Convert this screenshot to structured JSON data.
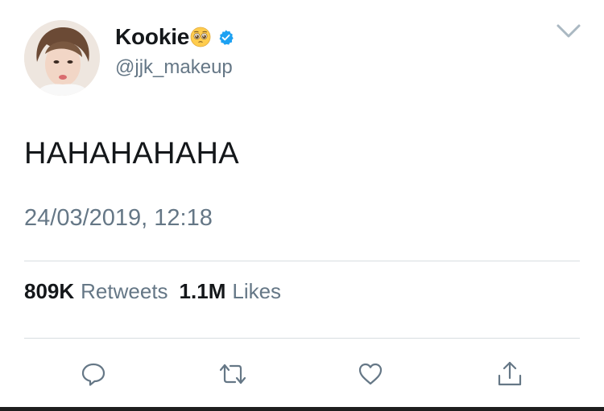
{
  "tweet": {
    "display_name": "Kookie",
    "name_emoji": "pleading-face-emoji",
    "verified_icon": "verified-badge-icon",
    "handle": "@jjk_makeup",
    "text": "HAHAHAHAHA",
    "timestamp": "24/03/2019, 12:18"
  },
  "stats": {
    "retweets_value": "809K",
    "retweets_label": "Retweets",
    "likes_value": "1.1M",
    "likes_label": "Likes"
  },
  "actions": [
    {
      "icon": "reply-icon"
    },
    {
      "icon": "retweet-icon"
    },
    {
      "icon": "like-icon"
    },
    {
      "icon": "share-icon"
    }
  ],
  "menu": {
    "icon": "chevron-down-icon"
  },
  "colors": {
    "text_primary": "#14171a",
    "text_secondary": "#657786",
    "verified_blue": "#1da1f2",
    "divider": "#d8dde1"
  }
}
